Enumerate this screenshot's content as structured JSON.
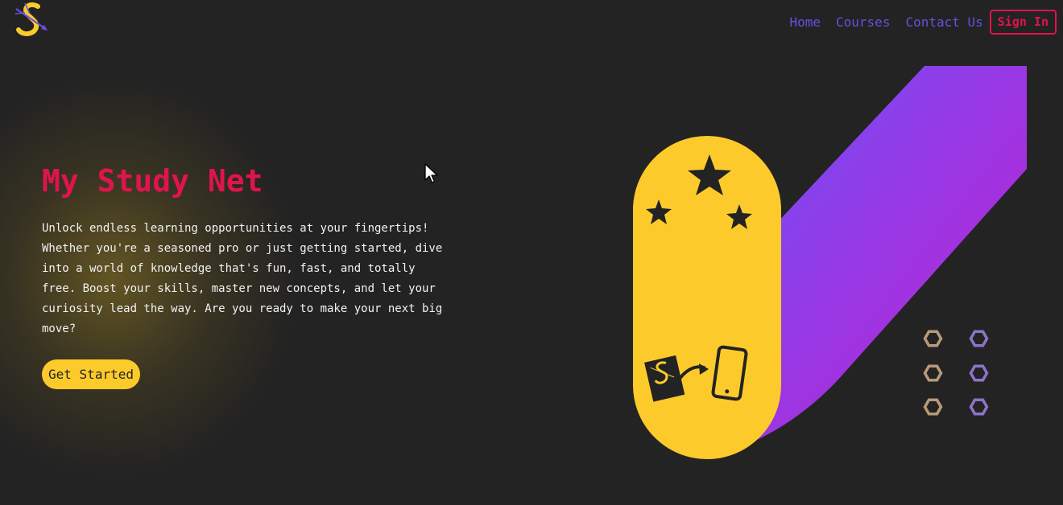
{
  "brand": {
    "logo_icon": "s-logo-icon",
    "primary_color": "#e0144d",
    "accent_color": "#6a4fe0",
    "highlight_color": "#fccb2b",
    "background_color": "#232323"
  },
  "nav": {
    "items": [
      {
        "label": "Home"
      },
      {
        "label": "Courses"
      },
      {
        "label": "Contact Us"
      }
    ],
    "sign_in_label": "Sign In"
  },
  "hero": {
    "title": "My Study Net",
    "description": "Unlock endless learning opportunities at your fingertips! Whether you're a seasoned pro or just getting started, dive into a world of knowledge that's fun, fast, and totally free. Boost your skills, master new concepts, and let your curiosity lead the way. Are you ready to make your next big move?",
    "cta_label": "Get Started"
  },
  "illustration": {
    "icons": [
      "star-icon",
      "star-icon",
      "star-icon",
      "document-icon",
      "arrow-icon",
      "phone-icon",
      "hexagon-icon"
    ],
    "hexagon_count": 6
  }
}
